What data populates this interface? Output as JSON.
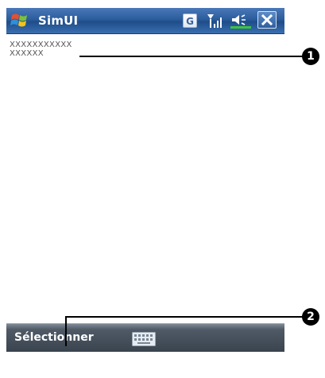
{
  "titlebar": {
    "app_title": "SimUI",
    "input_indicator": "G",
    "start_icon": "windows-flag-icon",
    "signal_icon": "signal-strength-icon",
    "volume_icon": "speaker-icon",
    "close_icon": "close-icon"
  },
  "content": {
    "lines": [
      "XXXXXXXXXXX",
      "XXXXXX"
    ]
  },
  "softkeys": {
    "left_label": "Sélectionner",
    "keyboard_icon": "keyboard-icon"
  },
  "callouts": {
    "one": "1",
    "two": "2"
  },
  "colors": {
    "titlebar": "#2b5c9c",
    "softkeybar": "#3a444f",
    "callout": "#000000"
  }
}
